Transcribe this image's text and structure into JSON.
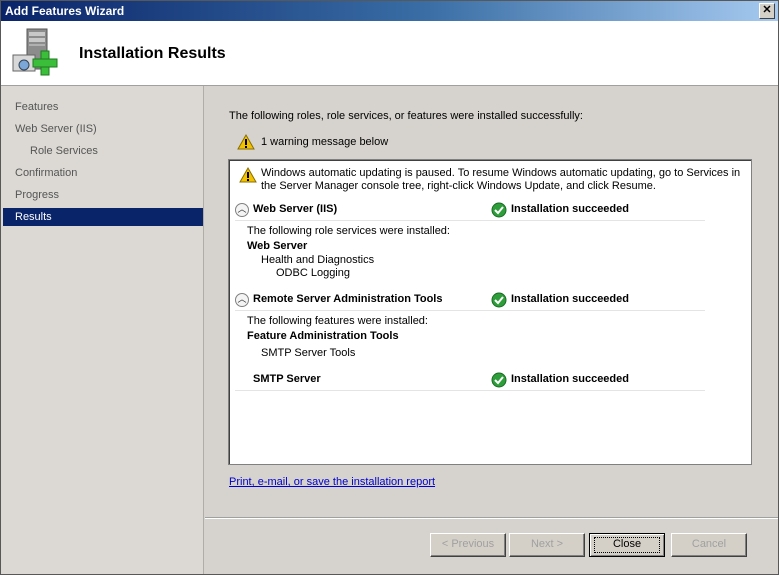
{
  "window": {
    "title": "Add Features Wizard",
    "close_glyph": "✕"
  },
  "header": {
    "title": "Installation Results",
    "icon": "server-add-icon"
  },
  "sidebar": {
    "items": [
      {
        "label": "Features",
        "active": false
      },
      {
        "label": "Web Server (IIS)",
        "active": false
      },
      {
        "label": "Role Services",
        "active": false,
        "indent": true
      },
      {
        "label": "Confirmation",
        "active": false
      },
      {
        "label": "Progress",
        "active": false
      },
      {
        "label": "Results",
        "active": true
      }
    ]
  },
  "main": {
    "intro": "The following roles, role services, or features were installed successfully:",
    "warning_count": "1 warning message below",
    "results": {
      "warning": "Windows automatic updating is paused. To resume Windows automatic updating, go to Services in the Server Manager console tree, right-click Windows Update, and click Resume.",
      "sections": [
        {
          "name": "Web Server (IIS)",
          "status": "Installation succeeded",
          "desc": "The following role services were installed:",
          "group": "Web Server",
          "sub": "Health and Diagnostics",
          "subsub": "ODBC Logging"
        },
        {
          "name": "Remote Server Administration Tools",
          "status": "Installation succeeded",
          "desc": "The following features were installed:",
          "group": "Feature Administration Tools",
          "sub": "SMTP Server Tools"
        },
        {
          "name": "SMTP Server",
          "status": "Installation succeeded"
        }
      ]
    },
    "report_link": "Print, e-mail, or save the installation report"
  },
  "buttons": {
    "previous": "< Previous",
    "next": "Next >",
    "close": "Close",
    "cancel": "Cancel"
  },
  "colors": {
    "accent": "#0a246a",
    "success": "#2e9e3a",
    "warning": "#f2c200",
    "link": "#0000cc"
  }
}
